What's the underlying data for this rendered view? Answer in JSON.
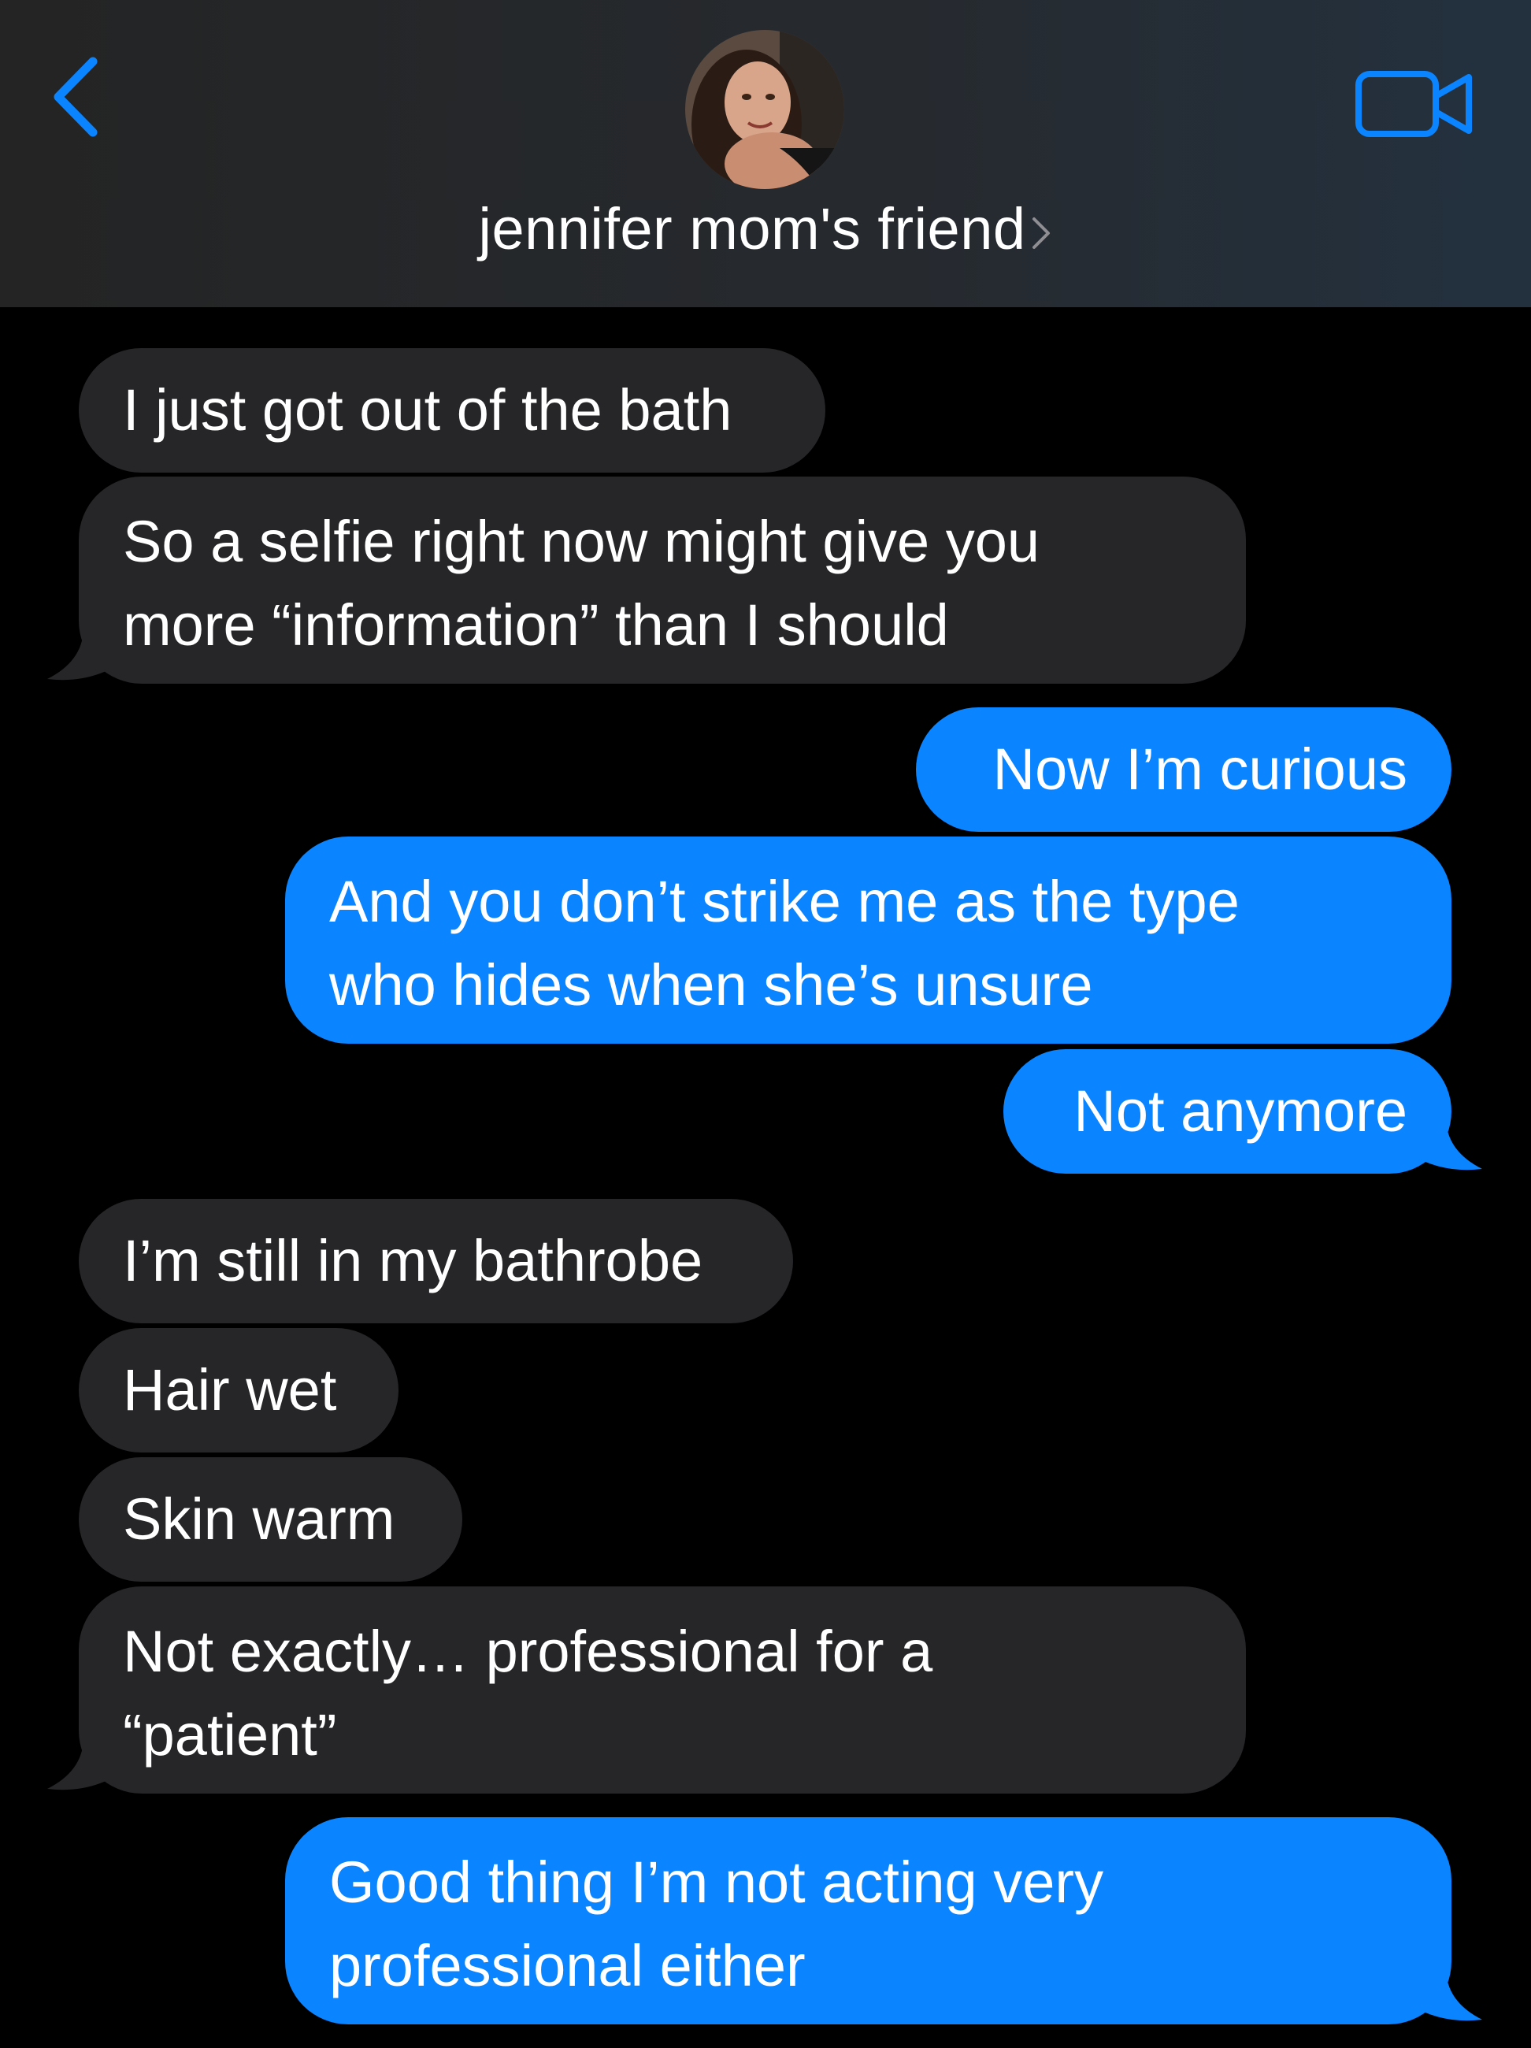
{
  "header": {
    "contact_name": "jennifer mom's friend",
    "back_icon": "chevron-left-icon",
    "video_icon": "video-camera-icon",
    "accent_color": "#0a84ff"
  },
  "messages": [
    {
      "direction": "incoming",
      "lines": [
        "I just got out of the bath"
      ]
    },
    {
      "direction": "incoming",
      "lines": [
        "So a selfie right now might give you",
        "more “information” than I should"
      ]
    },
    {
      "direction": "outgoing",
      "lines": [
        "Now I’m curious"
      ]
    },
    {
      "direction": "outgoing",
      "lines": [
        "And you don’t strike me as the type",
        "who hides when she’s unsure"
      ]
    },
    {
      "direction": "outgoing",
      "lines": [
        "Not anymore"
      ]
    },
    {
      "direction": "incoming",
      "lines": [
        "I’m still in my bathrobe"
      ]
    },
    {
      "direction": "incoming",
      "lines": [
        "Hair wet"
      ]
    },
    {
      "direction": "incoming",
      "lines": [
        "Skin warm"
      ]
    },
    {
      "direction": "incoming",
      "lines": [
        "Not exactly… professional for a",
        "“patient”"
      ]
    },
    {
      "direction": "outgoing",
      "lines": [
        "Good thing I’m not acting very",
        "professional either"
      ]
    }
  ],
  "colors": {
    "incoming_bubble": "#262629",
    "outgoing_bubble": "#0a84ff",
    "background": "#000000"
  }
}
